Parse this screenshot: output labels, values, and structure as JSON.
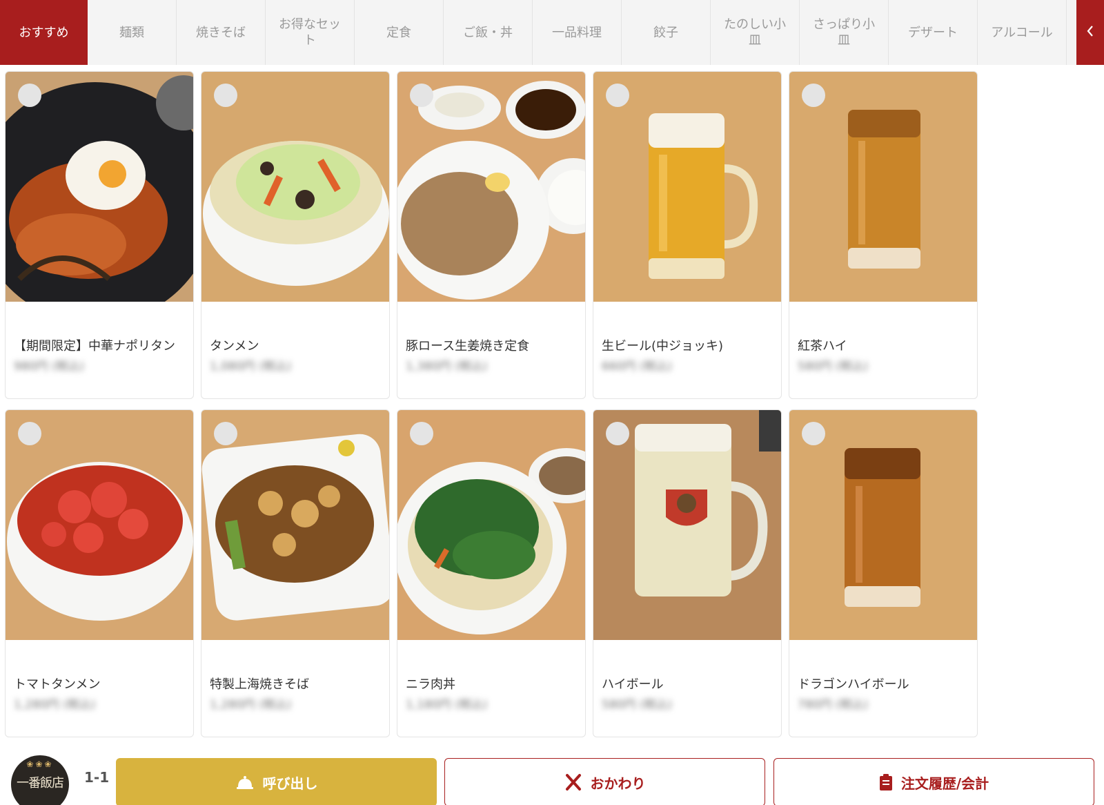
{
  "tabs": [
    {
      "label": "おすすめ",
      "active": true
    },
    {
      "label": "麺類",
      "active": false
    },
    {
      "label": "焼きそば",
      "active": false
    },
    {
      "label": "お得なセット",
      "active": false
    },
    {
      "label": "定食",
      "active": false
    },
    {
      "label": "ご飯・丼",
      "active": false
    },
    {
      "label": "一品料理",
      "active": false
    },
    {
      "label": "餃子",
      "active": false
    },
    {
      "label": "たのしい小皿",
      "active": false
    },
    {
      "label": "さっぱり小皿",
      "active": false
    },
    {
      "label": "デザート",
      "active": false
    },
    {
      "label": "アルコール",
      "active": false
    }
  ],
  "tab_scroll_icon": "chevron-left-icon",
  "items": [
    {
      "name": "【期間限定】中華ナポリタン",
      "price": "980円 (税込)",
      "photo": "napolitan"
    },
    {
      "name": "タンメン",
      "price": "1,080円 (税込)",
      "photo": "tanmen"
    },
    {
      "name": "豚ロース生姜焼き定食",
      "price": "1,380円 (税込)",
      "photo": "ginger-pork-set"
    },
    {
      "name": "生ビール(中ジョッキ)",
      "price": "660円 (税込)",
      "photo": "draft-beer"
    },
    {
      "name": "紅茶ハイ",
      "price": "580円 (税込)",
      "photo": "tea-highball"
    },
    {
      "name": "トマトタンメン",
      "price": "1,280円 (税込)",
      "photo": "tomato-tanmen"
    },
    {
      "name": "特製上海焼きそば",
      "price": "1,280円 (税込)",
      "photo": "shanghai-yakisoba"
    },
    {
      "name": "ニラ肉丼",
      "price": "1,180円 (税込)",
      "photo": "nira-meat-bowl"
    },
    {
      "name": "ハイボール",
      "price": "580円 (税込)",
      "photo": "highball"
    },
    {
      "name": "ドラゴンハイボール",
      "price": "780円 (税込)",
      "photo": "dragon-highball"
    }
  ],
  "footer": {
    "logo_text": "一番飯店",
    "table_no": "1-1",
    "call_label": "呼び出し",
    "call_icon": "bell-icon",
    "refill_label": "おかわり",
    "refill_icon": "cutlery-icon",
    "history_label": "注文履歴/会計",
    "history_icon": "clipboard-icon"
  },
  "colors": {
    "accent_red": "#a81e1e",
    "call_gold": "#d8b33e",
    "tab_bg": "#f4f4f4"
  }
}
